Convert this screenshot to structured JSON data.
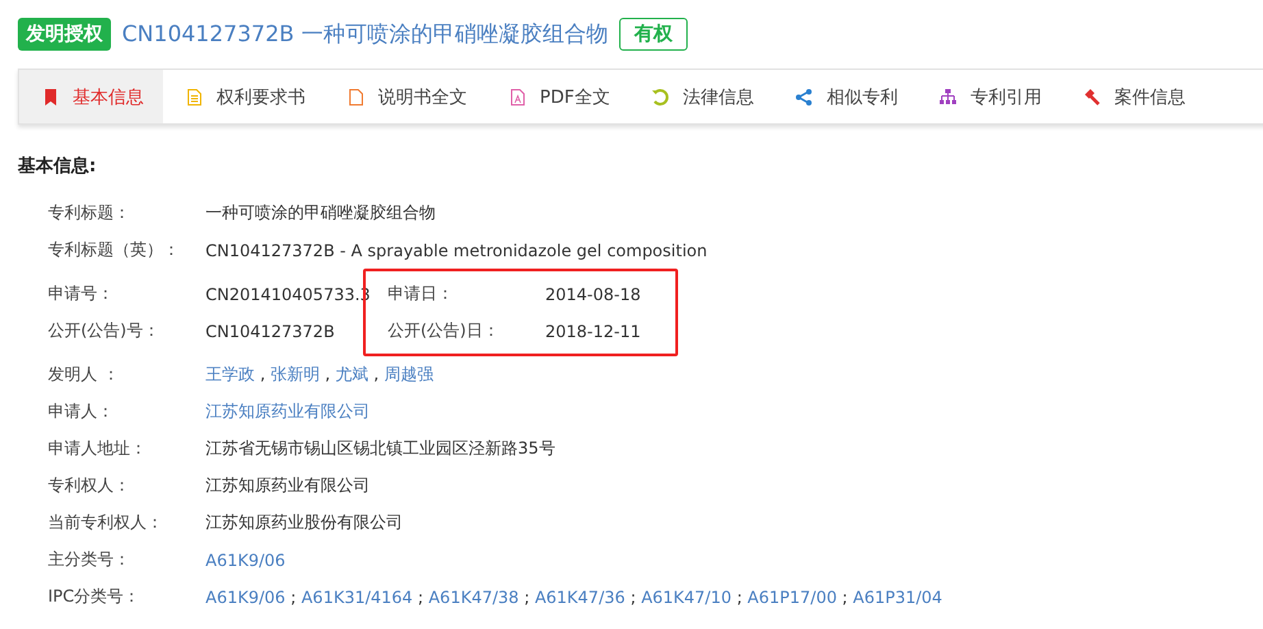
{
  "header": {
    "type_badge": "发明授权",
    "title": "CN104127372B 一种可喷涂的甲硝唑凝胶组合物",
    "status_badge": "有权"
  },
  "tabs": [
    {
      "label": "基本信息",
      "selected": true,
      "color": "#e02a2a"
    },
    {
      "label": "权利要求书",
      "selected": false,
      "color": "#f0b400"
    },
    {
      "label": "说明书全文",
      "selected": false,
      "color": "#f07a30"
    },
    {
      "label": "PDF全文",
      "selected": false,
      "color": "#e060a8"
    },
    {
      "label": "法律信息",
      "selected": false,
      "color": "#a8c020"
    },
    {
      "label": "相似专利",
      "selected": false,
      "color": "#2a80d0"
    },
    {
      "label": "专利引用",
      "selected": false,
      "color": "#a040c0"
    },
    {
      "label": "案件信息",
      "selected": false,
      "color": "#e03030"
    }
  ],
  "section_title": "基本信息:",
  "fields": [
    {
      "kind": "field",
      "label": "专利标题：",
      "value": " 一种可喷涂的甲硝唑凝胶组合物"
    },
    {
      "kind": "field",
      "label": "专利标题（英）：",
      "value": "CN104127372B - A sprayable metronidazole gel composition"
    },
    {
      "kind": "group",
      "highlighted": true,
      "left": [
        {
          "label": "申请号：",
          "value": "CN201410405733.3"
        },
        {
          "label": "公开(公告)号：",
          "value": "CN104127372B"
        }
      ],
      "right": [
        {
          "label": "申请日：",
          "value": "2014-08-18"
        },
        {
          "label": "公开(公告)日：",
          "value": "2018-12-11"
        }
      ]
    },
    {
      "kind": "links",
      "label": "发明人 ：",
      "links": [
        "王学政",
        "张新明",
        "尤斌",
        "周越强"
      ],
      "separator": " , "
    },
    {
      "kind": "links",
      "label": "申请人：",
      "links": [
        "江苏知原药业有限公司"
      ]
    },
    {
      "kind": "field",
      "label": "申请人地址：",
      "value": "江苏省无锡市锡山区锡北镇工业园区泾新路35号"
    },
    {
      "kind": "field",
      "label": "专利权人：",
      "value": "江苏知原药业有限公司"
    },
    {
      "kind": "field",
      "label": "当前专利权人：",
      "value": "江苏知原药业股份有限公司"
    },
    {
      "kind": "links",
      "label": "主分类号：",
      "links": [
        "A61K9/06"
      ]
    },
    {
      "kind": "links",
      "label": "IPC分类号：",
      "links": [
        "A61K9/06",
        "A61K31/4164",
        "A61K47/38",
        "A61K47/36",
        "A61K47/10",
        "A61P17/00",
        "A61P31/04"
      ],
      "separator": " ; "
    }
  ]
}
